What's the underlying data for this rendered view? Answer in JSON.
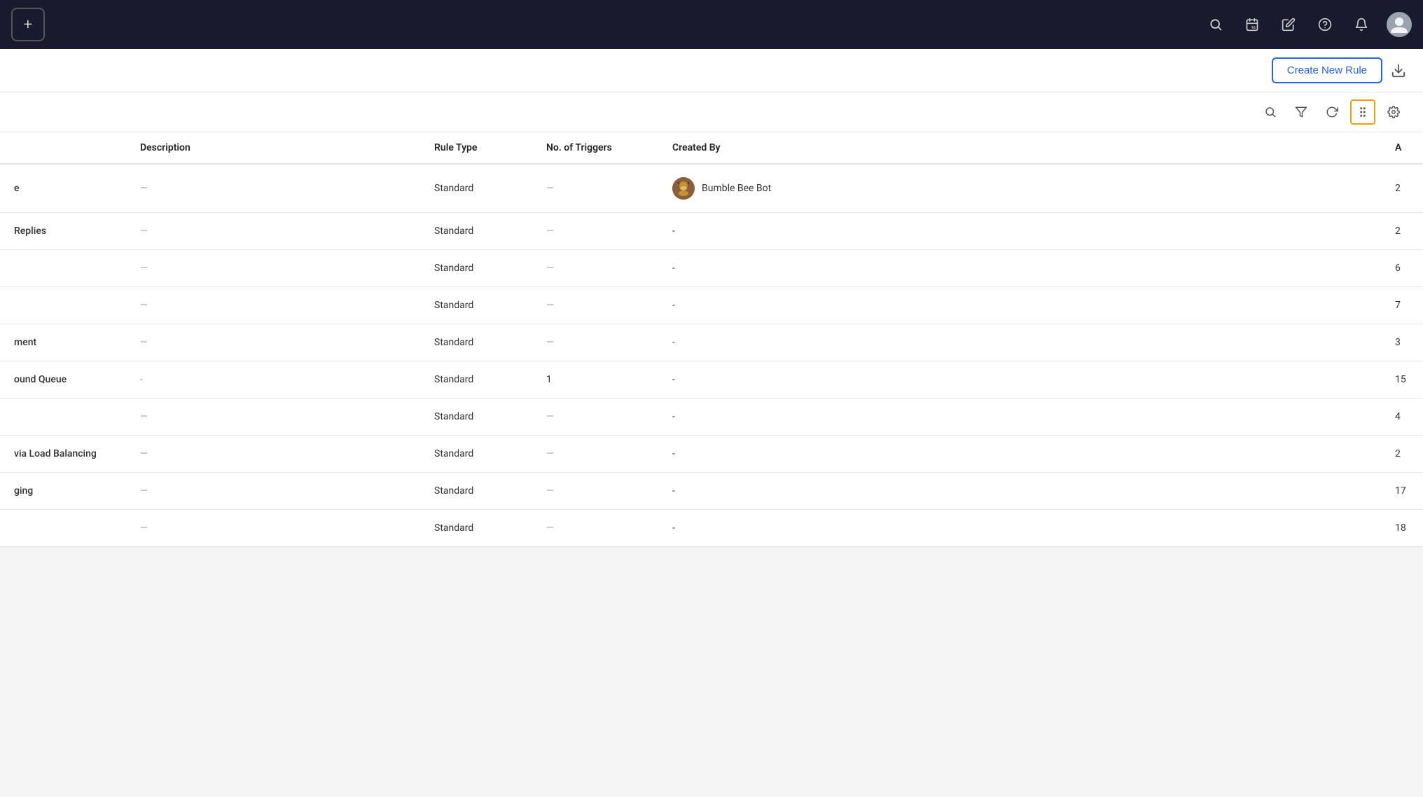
{
  "topbar": {
    "add_label": "+",
    "icons": [
      "search",
      "calendar",
      "edit",
      "help",
      "bell"
    ],
    "avatar_label": "User Avatar"
  },
  "action_bar": {
    "create_rule_label": "Create New Rule",
    "download_label": "Download"
  },
  "toolbar": {
    "search_label": "Search",
    "filter_label": "Filter",
    "refresh_label": "Refresh",
    "columns_label": "Columns",
    "settings_label": "Settings"
  },
  "table": {
    "columns": [
      {
        "key": "name",
        "label": ""
      },
      {
        "key": "description",
        "label": "Description"
      },
      {
        "key": "rule_type",
        "label": "Rule Type"
      },
      {
        "key": "triggers",
        "label": "No. of Triggers"
      },
      {
        "key": "created_by",
        "label": "Created By"
      },
      {
        "key": "action",
        "label": "A"
      }
    ],
    "rows": [
      {
        "name": "e",
        "description": "—",
        "rule_type": "Standard",
        "triggers": "—",
        "created_by": "Bumble Bee Bot",
        "created_by_avatar": true,
        "action": "2"
      },
      {
        "name": "Replies",
        "description": "—",
        "rule_type": "Standard",
        "triggers": "—",
        "created_by": "-",
        "created_by_avatar": false,
        "action": "2"
      },
      {
        "name": "",
        "description": "—",
        "rule_type": "Standard",
        "triggers": "—",
        "created_by": "-",
        "created_by_avatar": false,
        "action": "6"
      },
      {
        "name": "",
        "description": "—",
        "rule_type": "Standard",
        "triggers": "—",
        "created_by": "-",
        "created_by_avatar": false,
        "action": "7"
      },
      {
        "name": "ment",
        "description": "—",
        "rule_type": "Standard",
        "triggers": "—",
        "created_by": "-",
        "created_by_avatar": false,
        "action": "3"
      },
      {
        "name": "ound Queue",
        "description": "-",
        "rule_type": "Standard",
        "triggers": "1",
        "created_by": "-",
        "created_by_avatar": false,
        "action": "15"
      },
      {
        "name": "",
        "description": "—",
        "rule_type": "Standard",
        "triggers": "—",
        "created_by": "-",
        "created_by_avatar": false,
        "action": "4"
      },
      {
        "name": "via Load Balancing",
        "description": "—",
        "rule_type": "Standard",
        "triggers": "—",
        "created_by": "-",
        "created_by_avatar": false,
        "action": "2"
      },
      {
        "name": "ging",
        "description": "—",
        "rule_type": "Standard",
        "triggers": "—",
        "created_by": "-",
        "created_by_avatar": false,
        "action": "17"
      },
      {
        "name": "",
        "description": "—",
        "rule_type": "Standard",
        "triggers": "—",
        "created_by": "-",
        "created_by_avatar": false,
        "action": "18"
      }
    ]
  },
  "colors": {
    "topbar_bg": "#1a1a2e",
    "create_rule_border": "#2563eb",
    "active_toolbar_border": "#f59e0b"
  }
}
